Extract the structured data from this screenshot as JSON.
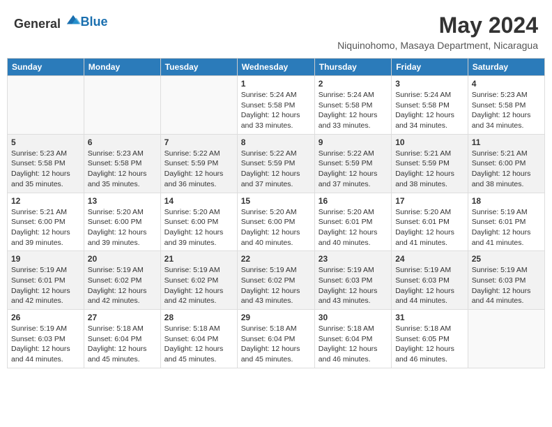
{
  "header": {
    "logo_general": "General",
    "logo_blue": "Blue",
    "title": "May 2024",
    "subtitle": "Niquinohomo, Masaya Department, Nicaragua"
  },
  "weekdays": [
    "Sunday",
    "Monday",
    "Tuesday",
    "Wednesday",
    "Thursday",
    "Friday",
    "Saturday"
  ],
  "weeks": [
    [
      {
        "day": "",
        "info": ""
      },
      {
        "day": "",
        "info": ""
      },
      {
        "day": "",
        "info": ""
      },
      {
        "day": "1",
        "info": "Sunrise: 5:24 AM\nSunset: 5:58 PM\nDaylight: 12 hours\nand 33 minutes."
      },
      {
        "day": "2",
        "info": "Sunrise: 5:24 AM\nSunset: 5:58 PM\nDaylight: 12 hours\nand 33 minutes."
      },
      {
        "day": "3",
        "info": "Sunrise: 5:24 AM\nSunset: 5:58 PM\nDaylight: 12 hours\nand 34 minutes."
      },
      {
        "day": "4",
        "info": "Sunrise: 5:23 AM\nSunset: 5:58 PM\nDaylight: 12 hours\nand 34 minutes."
      }
    ],
    [
      {
        "day": "5",
        "info": "Sunrise: 5:23 AM\nSunset: 5:58 PM\nDaylight: 12 hours\nand 35 minutes."
      },
      {
        "day": "6",
        "info": "Sunrise: 5:23 AM\nSunset: 5:58 PM\nDaylight: 12 hours\nand 35 minutes."
      },
      {
        "day": "7",
        "info": "Sunrise: 5:22 AM\nSunset: 5:59 PM\nDaylight: 12 hours\nand 36 minutes."
      },
      {
        "day": "8",
        "info": "Sunrise: 5:22 AM\nSunset: 5:59 PM\nDaylight: 12 hours\nand 37 minutes."
      },
      {
        "day": "9",
        "info": "Sunrise: 5:22 AM\nSunset: 5:59 PM\nDaylight: 12 hours\nand 37 minutes."
      },
      {
        "day": "10",
        "info": "Sunrise: 5:21 AM\nSunset: 5:59 PM\nDaylight: 12 hours\nand 38 minutes."
      },
      {
        "day": "11",
        "info": "Sunrise: 5:21 AM\nSunset: 6:00 PM\nDaylight: 12 hours\nand 38 minutes."
      }
    ],
    [
      {
        "day": "12",
        "info": "Sunrise: 5:21 AM\nSunset: 6:00 PM\nDaylight: 12 hours\nand 39 minutes."
      },
      {
        "day": "13",
        "info": "Sunrise: 5:20 AM\nSunset: 6:00 PM\nDaylight: 12 hours\nand 39 minutes."
      },
      {
        "day": "14",
        "info": "Sunrise: 5:20 AM\nSunset: 6:00 PM\nDaylight: 12 hours\nand 39 minutes."
      },
      {
        "day": "15",
        "info": "Sunrise: 5:20 AM\nSunset: 6:00 PM\nDaylight: 12 hours\nand 40 minutes."
      },
      {
        "day": "16",
        "info": "Sunrise: 5:20 AM\nSunset: 6:01 PM\nDaylight: 12 hours\nand 40 minutes."
      },
      {
        "day": "17",
        "info": "Sunrise: 5:20 AM\nSunset: 6:01 PM\nDaylight: 12 hours\nand 41 minutes."
      },
      {
        "day": "18",
        "info": "Sunrise: 5:19 AM\nSunset: 6:01 PM\nDaylight: 12 hours\nand 41 minutes."
      }
    ],
    [
      {
        "day": "19",
        "info": "Sunrise: 5:19 AM\nSunset: 6:01 PM\nDaylight: 12 hours\nand 42 minutes."
      },
      {
        "day": "20",
        "info": "Sunrise: 5:19 AM\nSunset: 6:02 PM\nDaylight: 12 hours\nand 42 minutes."
      },
      {
        "day": "21",
        "info": "Sunrise: 5:19 AM\nSunset: 6:02 PM\nDaylight: 12 hours\nand 42 minutes."
      },
      {
        "day": "22",
        "info": "Sunrise: 5:19 AM\nSunset: 6:02 PM\nDaylight: 12 hours\nand 43 minutes."
      },
      {
        "day": "23",
        "info": "Sunrise: 5:19 AM\nSunset: 6:03 PM\nDaylight: 12 hours\nand 43 minutes."
      },
      {
        "day": "24",
        "info": "Sunrise: 5:19 AM\nSunset: 6:03 PM\nDaylight: 12 hours\nand 44 minutes."
      },
      {
        "day": "25",
        "info": "Sunrise: 5:19 AM\nSunset: 6:03 PM\nDaylight: 12 hours\nand 44 minutes."
      }
    ],
    [
      {
        "day": "26",
        "info": "Sunrise: 5:19 AM\nSunset: 6:03 PM\nDaylight: 12 hours\nand 44 minutes."
      },
      {
        "day": "27",
        "info": "Sunrise: 5:18 AM\nSunset: 6:04 PM\nDaylight: 12 hours\nand 45 minutes."
      },
      {
        "day": "28",
        "info": "Sunrise: 5:18 AM\nSunset: 6:04 PM\nDaylight: 12 hours\nand 45 minutes."
      },
      {
        "day": "29",
        "info": "Sunrise: 5:18 AM\nSunset: 6:04 PM\nDaylight: 12 hours\nand 45 minutes."
      },
      {
        "day": "30",
        "info": "Sunrise: 5:18 AM\nSunset: 6:04 PM\nDaylight: 12 hours\nand 46 minutes."
      },
      {
        "day": "31",
        "info": "Sunrise: 5:18 AM\nSunset: 6:05 PM\nDaylight: 12 hours\nand 46 minutes."
      },
      {
        "day": "",
        "info": ""
      }
    ]
  ]
}
